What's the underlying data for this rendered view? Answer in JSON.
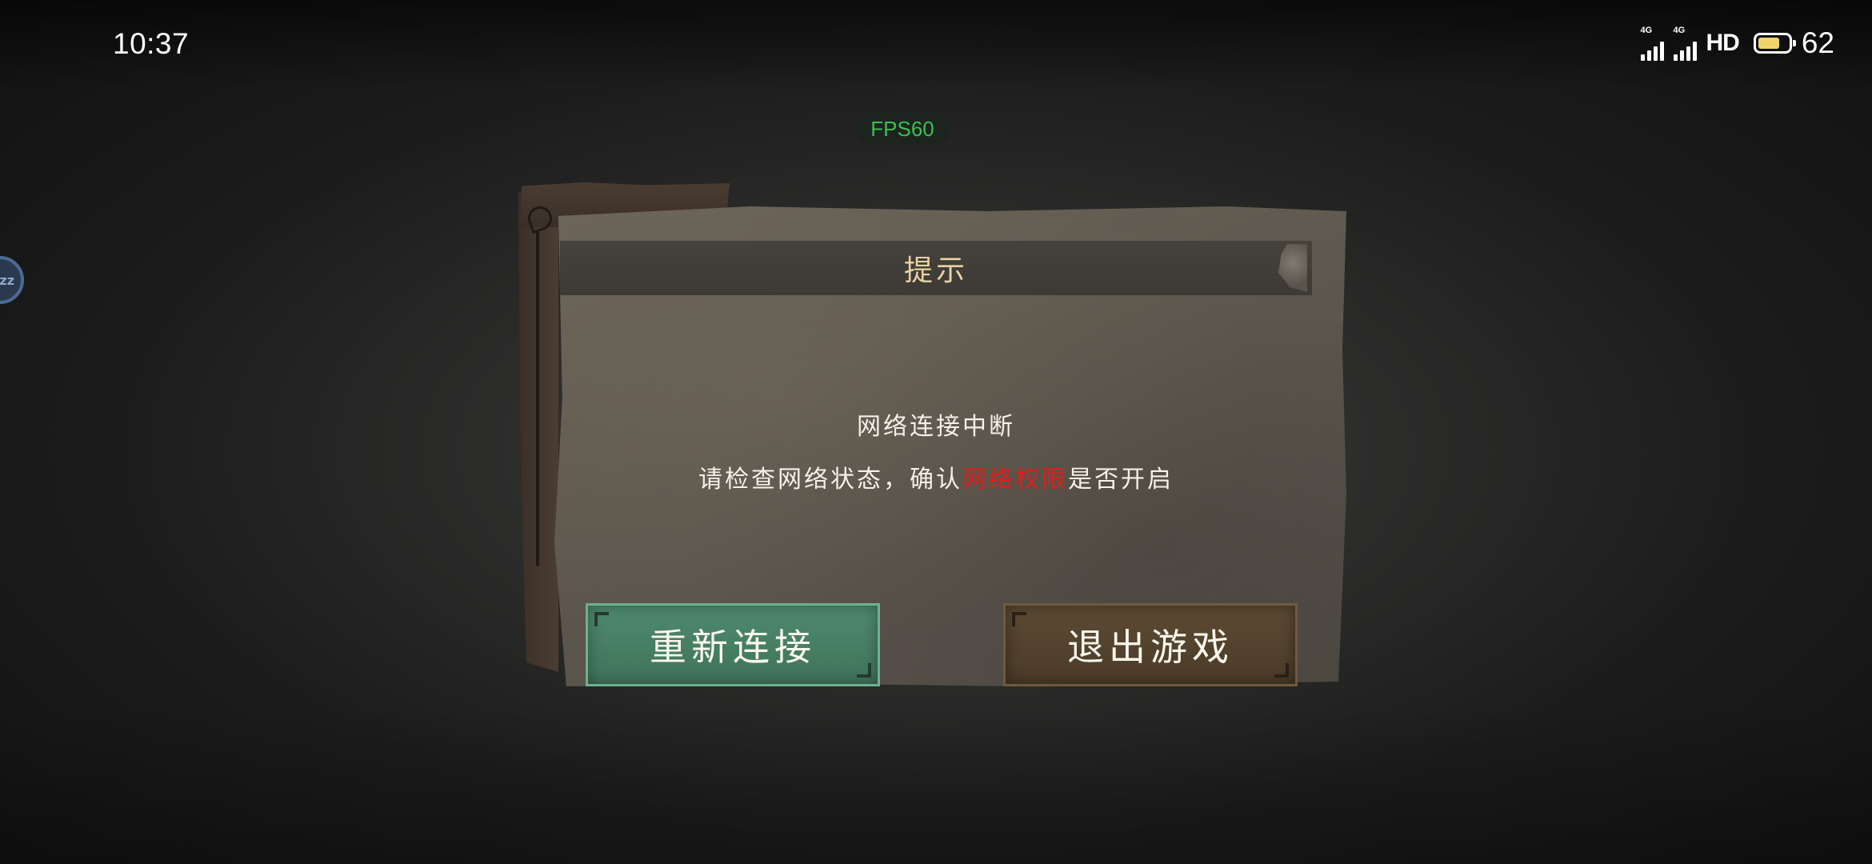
{
  "status_bar": {
    "time": "10:37",
    "network_type_1": "4G",
    "network_type_2": "4G",
    "hd_label": "HD",
    "battery_level": "62",
    "battery_fraction": 0.62
  },
  "overlay": {
    "fps_label": "FPS60",
    "float_bubble_text": "zz"
  },
  "dialog": {
    "title": "提示",
    "message_line1": "网络连接中断",
    "message_line2_prefix": "请检查网络状态，确认",
    "message_line2_highlight": "网络权限",
    "message_line2_suffix": "是否开启",
    "highlight_color": "#e01e1e",
    "reconnect_button": "重新连接",
    "quit_button": "退出游戏"
  }
}
